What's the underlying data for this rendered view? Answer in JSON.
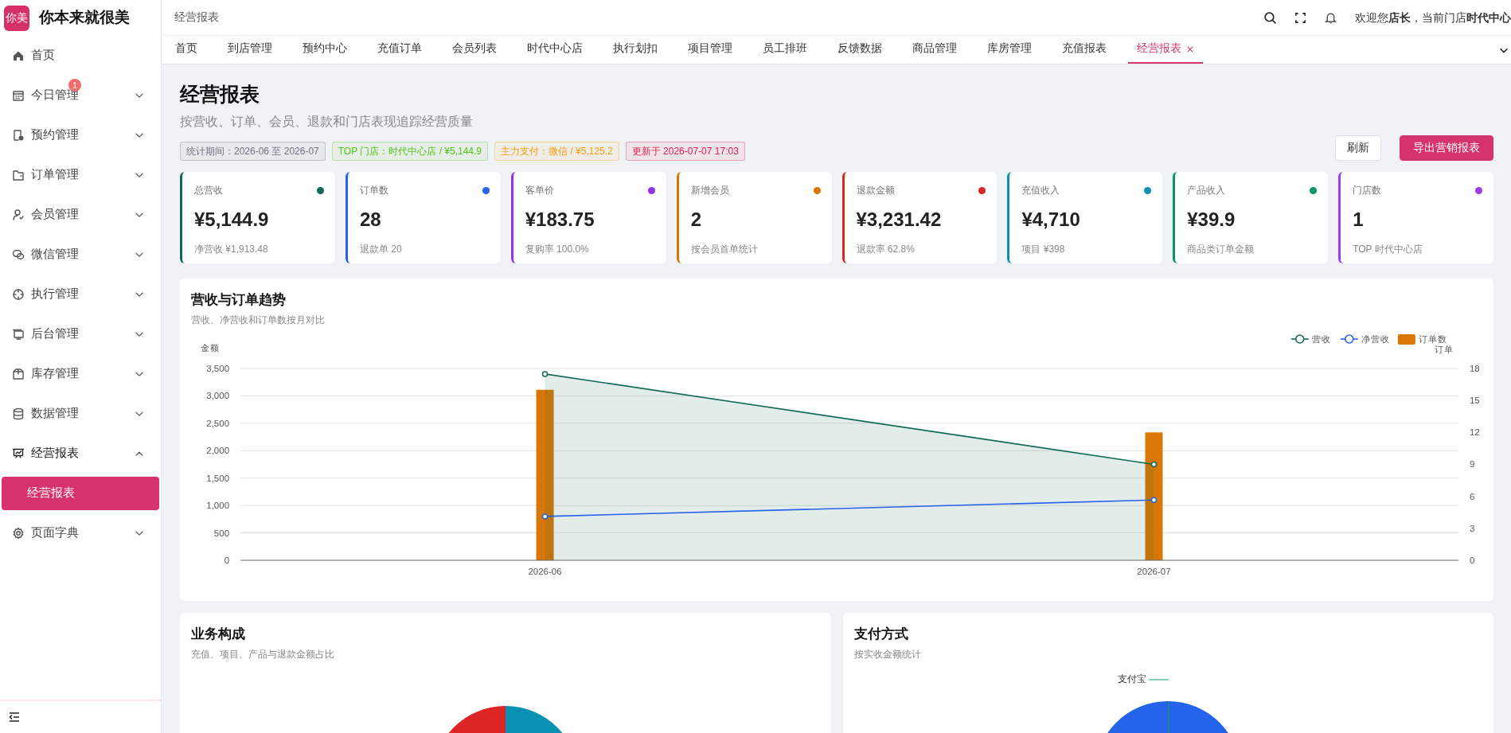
{
  "brand": {
    "logo": "你美",
    "name": "你本来就很美"
  },
  "sidebar": {
    "items": [
      {
        "label": "首页",
        "kind": "link"
      },
      {
        "label": "今日管理",
        "kind": "group",
        "expanded": false,
        "badge": "1"
      },
      {
        "label": "预约管理",
        "kind": "group",
        "expanded": false
      },
      {
        "label": "订单管理",
        "kind": "group",
        "expanded": false
      },
      {
        "label": "会员管理",
        "kind": "group",
        "expanded": false
      },
      {
        "label": "微信管理",
        "kind": "group",
        "expanded": false
      },
      {
        "label": "执行管理",
        "kind": "group",
        "expanded": false
      },
      {
        "label": "后台管理",
        "kind": "group",
        "expanded": false
      },
      {
        "label": "库存管理",
        "kind": "group",
        "expanded": false
      },
      {
        "label": "数据管理",
        "kind": "group",
        "expanded": false
      },
      {
        "label": "经营报表",
        "kind": "group",
        "expanded": true,
        "children": [
          {
            "label": "经营报表",
            "selected": true
          }
        ]
      },
      {
        "label": "页面字典",
        "kind": "group",
        "expanded": false
      }
    ]
  },
  "header": {
    "breadcrumb": "经营报表",
    "welcome": "欢迎您**店长**，当前门店**时代中心**"
  },
  "tabs": [
    {
      "label": "首页",
      "selected": false
    },
    {
      "label": "到店管理",
      "selected": false
    },
    {
      "label": "预约中心",
      "selected": false
    },
    {
      "label": "充值订单",
      "selected": false
    },
    {
      "label": "会员列表",
      "selected": false
    },
    {
      "label": "时代中心店",
      "selected": false
    },
    {
      "label": "执行划扣",
      "selected": false
    },
    {
      "label": "项目管理",
      "selected": false
    },
    {
      "label": "员工排班",
      "selected": false
    },
    {
      "label": "反馈数据",
      "selected": false
    },
    {
      "label": "商品管理",
      "selected": false
    },
    {
      "label": "库房管理",
      "selected": false
    },
    {
      "label": "充值报表",
      "selected": false
    },
    {
      "label": "经营报表",
      "selected": true
    }
  ],
  "page": {
    "title": "经营报表",
    "subtitle": "按营收、订单、会员、退款和门店表现追踪经营质量",
    "tags": [
      {
        "text": "统计期间：2026-06 至 2026-07",
        "color": "#6b7280"
      },
      {
        "text": "TOP 门店：时代中心店 / ¥5,144.9",
        "color": "#52c41a"
      },
      {
        "text": "主力支付：微信 / ¥5,125.2",
        "color": "#f59e0b"
      },
      {
        "text": "更新于 2026-07-07 17:03",
        "color": "#e11d48"
      }
    ],
    "buttons": [
      {
        "label": "刷新",
        "kind": "secondary"
      },
      {
        "label": "导出营销报表",
        "kind": "primary"
      }
    ]
  },
  "stats": [
    {
      "label": "总营收",
      "value": "¥5,144.9",
      "note": "净营收 ¥1,913.48",
      "color": "#0f6b55"
    },
    {
      "label": "订单数",
      "value": "28",
      "note": "退款单 20",
      "color": "#2563eb"
    },
    {
      "label": "客单价",
      "value": "¥183.75",
      "note": "复购率 100.0%",
      "color": "#9333ea"
    },
    {
      "label": "新增会员",
      "value": "2",
      "note": "按会员首单统计",
      "color": "#d97706"
    },
    {
      "label": "退款金额",
      "value": "¥3,231.42",
      "note": "退款率 62.8%",
      "color": "#dc2626"
    },
    {
      "label": "充值收入",
      "value": "¥4,710",
      "note": "项目 ¥398",
      "color": "#0891b2"
    },
    {
      "label": "产品收入",
      "value": "¥39.9",
      "note": "商品类订单金额",
      "color": "#059669"
    },
    {
      "label": "门店数",
      "value": "1",
      "note": "TOP 时代中心店",
      "color": "#a03ae8"
    }
  ],
  "trend": {
    "title": "营收与订单趋势",
    "subtitle": "营收、净营收和订单数按月对比",
    "chart_data": {
      "type": "line",
      "ylabel": "金额",
      "y2label": "订单",
      "categories": [
        "2026-06",
        "2026-07"
      ],
      "ylim": [
        0,
        3500
      ],
      "yticks": [
        {
          "value": 0,
          "label": "0"
        },
        {
          "value": 500,
          "label": "500"
        },
        {
          "value": 1000,
          "label": "1,000"
        },
        {
          "value": 1500,
          "label": "1,500"
        },
        {
          "value": 2000,
          "label": "2,000"
        },
        {
          "value": 2500,
          "label": "2,500"
        },
        {
          "value": 3000,
          "label": "3,000"
        },
        {
          "value": 3500,
          "label": "3,500"
        }
      ],
      "y2lim": [
        0,
        18
      ],
      "y2ticks": [
        0,
        3,
        6,
        9,
        12,
        15,
        18
      ],
      "grid": true,
      "legend": true,
      "series": [
        {
          "name": "营收",
          "type": "area",
          "marker": "circle",
          "color": "#0f6b55",
          "values": [
            3400,
            1750
          ]
        },
        {
          "name": "净营收",
          "type": "line",
          "marker": "circle",
          "color": "#2563eb",
          "values": [
            800,
            1100
          ]
        },
        {
          "name": "订单数",
          "type": "bar",
          "axis": "y2",
          "color": "#d97706",
          "values": [
            16,
            12
          ]
        }
      ]
    }
  },
  "composition": {
    "title": "业务构成",
    "subtitle": "充值、项目、产品与退款金额占比"
  },
  "payment": {
    "title": "支付方式",
    "subtitle": "按实收金额统计",
    "label": "支付宝"
  }
}
